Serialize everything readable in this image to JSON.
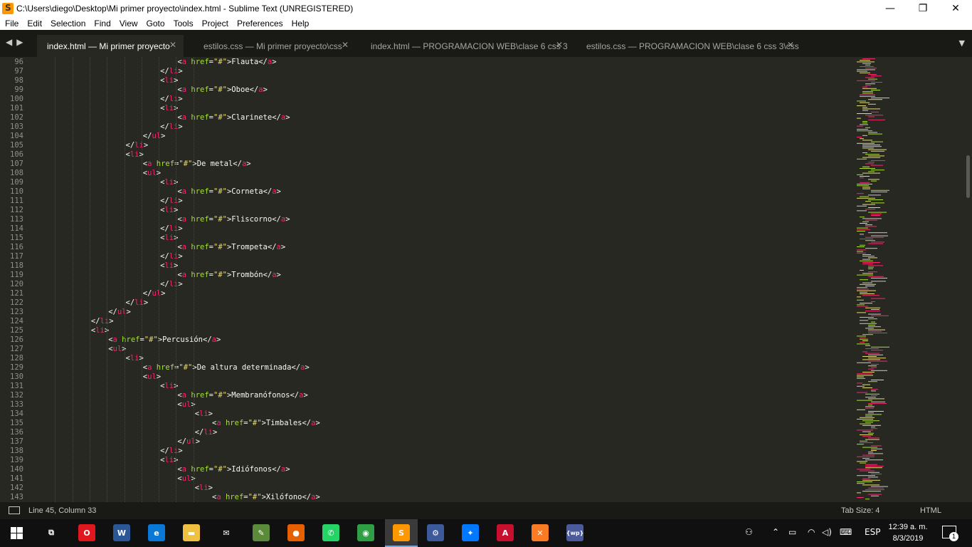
{
  "window": {
    "title": "C:\\Users\\diego\\Desktop\\Mi primer proyecto\\index.html - Sublime Text (UNREGISTERED)",
    "controls": {
      "minimize": "—",
      "maximize": "❐",
      "close": "✕"
    }
  },
  "menu": [
    "File",
    "Edit",
    "Selection",
    "Find",
    "View",
    "Goto",
    "Tools",
    "Project",
    "Preferences",
    "Help"
  ],
  "tabs": [
    {
      "label": "index.html — Mi primer proyecto",
      "active": true
    },
    {
      "label": "estilos.css — Mi primer proyecto\\css",
      "active": false
    },
    {
      "label": "index.html — PROGRAMACION  WEB\\clase 6 css 3",
      "active": false
    },
    {
      "label": "estilos.css — PROGRAMACION  WEB\\clase 6 css 3\\css",
      "active": false
    }
  ],
  "tab_close_glyph": "✕",
  "nav": {
    "back": "◀",
    "forward": "▶",
    "tab_menu": "▼"
  },
  "editor": {
    "lines": [
      {
        "n": 96,
        "indent": 8,
        "kind": "a",
        "text": "Flauta"
      },
      {
        "n": 97,
        "indent": 7,
        "kind": "close",
        "tag": "li"
      },
      {
        "n": 98,
        "indent": 7,
        "kind": "open",
        "tag": "li"
      },
      {
        "n": 99,
        "indent": 8,
        "kind": "a",
        "text": "Oboe"
      },
      {
        "n": 100,
        "indent": 7,
        "kind": "close",
        "tag": "li"
      },
      {
        "n": 101,
        "indent": 7,
        "kind": "open",
        "tag": "li"
      },
      {
        "n": 102,
        "indent": 8,
        "kind": "a",
        "text": "Clarinete"
      },
      {
        "n": 103,
        "indent": 7,
        "kind": "close",
        "tag": "li"
      },
      {
        "n": 104,
        "indent": 6,
        "kind": "close",
        "tag": "ul"
      },
      {
        "n": 105,
        "indent": 5,
        "kind": "close",
        "tag": "li"
      },
      {
        "n": 106,
        "indent": 5,
        "kind": "open",
        "tag": "li"
      },
      {
        "n": 107,
        "indent": 6,
        "kind": "a",
        "text": "De metal"
      },
      {
        "n": 108,
        "indent": 6,
        "kind": "open",
        "tag": "ul"
      },
      {
        "n": 109,
        "indent": 7,
        "kind": "open",
        "tag": "li"
      },
      {
        "n": 110,
        "indent": 8,
        "kind": "a",
        "text": "Corneta"
      },
      {
        "n": 111,
        "indent": 7,
        "kind": "close",
        "tag": "li"
      },
      {
        "n": 112,
        "indent": 7,
        "kind": "open",
        "tag": "li"
      },
      {
        "n": 113,
        "indent": 8,
        "kind": "a",
        "text": "Fliscorno"
      },
      {
        "n": 114,
        "indent": 7,
        "kind": "close",
        "tag": "li"
      },
      {
        "n": 115,
        "indent": 7,
        "kind": "open",
        "tag": "li"
      },
      {
        "n": 116,
        "indent": 8,
        "kind": "a",
        "text": "Trompeta"
      },
      {
        "n": 117,
        "indent": 7,
        "kind": "close",
        "tag": "li"
      },
      {
        "n": 118,
        "indent": 7,
        "kind": "open",
        "tag": "li"
      },
      {
        "n": 119,
        "indent": 8,
        "kind": "a",
        "text": "Trombón"
      },
      {
        "n": 120,
        "indent": 7,
        "kind": "close",
        "tag": "li"
      },
      {
        "n": 121,
        "indent": 6,
        "kind": "close",
        "tag": "ul"
      },
      {
        "n": 122,
        "indent": 5,
        "kind": "close",
        "tag": "li"
      },
      {
        "n": 123,
        "indent": 4,
        "kind": "close",
        "tag": "ul"
      },
      {
        "n": 124,
        "indent": 3,
        "kind": "close",
        "tag": "li"
      },
      {
        "n": 125,
        "indent": 3,
        "kind": "open",
        "tag": "li"
      },
      {
        "n": 126,
        "indent": 4,
        "kind": "a",
        "text": "Percusión"
      },
      {
        "n": 127,
        "indent": 4,
        "kind": "open",
        "tag": "ul"
      },
      {
        "n": 128,
        "indent": 5,
        "kind": "open",
        "tag": "li"
      },
      {
        "n": 129,
        "indent": 6,
        "kind": "a",
        "text": "De altura determinada"
      },
      {
        "n": 130,
        "indent": 6,
        "kind": "open",
        "tag": "ul"
      },
      {
        "n": 131,
        "indent": 7,
        "kind": "open",
        "tag": "li"
      },
      {
        "n": 132,
        "indent": 8,
        "kind": "a",
        "text": "Membranófonos"
      },
      {
        "n": 133,
        "indent": 8,
        "kind": "open",
        "tag": "ul"
      },
      {
        "n": 134,
        "indent": 9,
        "kind": "open",
        "tag": "li"
      },
      {
        "n": 135,
        "indent": 10,
        "kind": "a",
        "text": "Timbales"
      },
      {
        "n": 136,
        "indent": 9,
        "kind": "close",
        "tag": "li"
      },
      {
        "n": 137,
        "indent": 8,
        "kind": "close",
        "tag": "ul"
      },
      {
        "n": 138,
        "indent": 7,
        "kind": "close",
        "tag": "li"
      },
      {
        "n": 139,
        "indent": 7,
        "kind": "open",
        "tag": "li"
      },
      {
        "n": 140,
        "indent": 8,
        "kind": "a",
        "text": "Idiófonos"
      },
      {
        "n": 141,
        "indent": 8,
        "kind": "open",
        "tag": "ul"
      },
      {
        "n": 142,
        "indent": 9,
        "kind": "open",
        "tag": "li"
      },
      {
        "n": 143,
        "indent": 10,
        "kind": "a",
        "text": "Xilófono"
      }
    ]
  },
  "status": {
    "position": "Line 45, Column 33",
    "tab_size": "Tab Size: 4",
    "syntax": "HTML"
  },
  "taskbar": {
    "icons": [
      {
        "name": "task-view-icon",
        "glyph": "⧉",
        "color": "#101010"
      },
      {
        "name": "opera-icon",
        "glyph": "O",
        "color": "#e0181e"
      },
      {
        "name": "word-icon",
        "glyph": "W",
        "color": "#2b5797"
      },
      {
        "name": "edge-icon",
        "glyph": "e",
        "color": "#0a78d7"
      },
      {
        "name": "file-explorer-icon",
        "glyph": "▬",
        "color": "#f0c040"
      },
      {
        "name": "mail-icon",
        "glyph": "✉",
        "color": "#101010"
      },
      {
        "name": "paint-icon",
        "glyph": "✎",
        "color": "#5b8a3a"
      },
      {
        "name": "firefox-icon",
        "glyph": "●",
        "color": "#e66000"
      },
      {
        "name": "whatsapp-icon",
        "glyph": "✆",
        "color": "#25d366"
      },
      {
        "name": "chrome-icon",
        "glyph": "◉",
        "color": "#2f9e44"
      },
      {
        "name": "sublime-text-icon",
        "glyph": "S",
        "color": "#ff9800"
      },
      {
        "name": "settings-app-icon",
        "glyph": "⚙",
        "color": "#3c5a99"
      },
      {
        "name": "messenger-icon",
        "glyph": "✦",
        "color": "#0078ff"
      },
      {
        "name": "acrobat-icon",
        "glyph": "A",
        "color": "#c8102e"
      },
      {
        "name": "xampp-icon",
        "glyph": "✕",
        "color": "#fb7a24"
      },
      {
        "name": "bwp-icon",
        "glyph": "{wp}",
        "color": "#4a5a9a"
      }
    ],
    "tray": {
      "people": "⚇",
      "chevron": "⌃",
      "battery": "▭",
      "network": "◠",
      "volume": "◁)",
      "keyboard": "⌨",
      "language": "ESP"
    },
    "clock_time": "12:39 a. m.",
    "clock_date": "8/3/2019",
    "notifications": "1"
  },
  "colors": {
    "background": "#272822",
    "tag": "#f92672",
    "attribute": "#a6e22e",
    "string": "#e6db74",
    "text": "#f8f8f2",
    "gutter_text": "#90908a"
  }
}
